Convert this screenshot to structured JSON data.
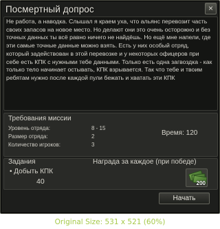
{
  "window": {
    "title": "Посмертный допрос",
    "close_label": "×"
  },
  "description": "Не работа, а наводка. Слышал я краем уха, что альянс перевозит часть своих запасов на новое место. Но делают они это очень осторожно и без точных данных ты всё равно ничего не найдёшь. Но ещё мне напели, где эти самые точные данные можно взять. Есть у них особый отряд, который задействован в этой перевозке и у некоторых офицеров при себе есть КПК с нужными тебе данными. Только есть одна загвоздка - как только тело начинает остывать, КПК взрывается. Так что тебе и твоим ребятам нужно после каждой пули бежать и хватать эти КПК",
  "mission": {
    "heading": "Требования миссии",
    "requirements": [
      {
        "label": "Уровень отряда:",
        "value": "8 - 15"
      },
      {
        "label": "Размер отряда:",
        "value": "2"
      },
      {
        "label": "Количество игроков:",
        "value": "3"
      }
    ],
    "time": "Время: 120"
  },
  "tasks": {
    "heading": "Задания",
    "reward_heading": "Награда за каждое (при победе)",
    "items": [
      {
        "name": "Добыть КПК",
        "bullet": "•",
        "count": "40",
        "reward_icon": "money-bills-icon",
        "reward_amount": "200"
      }
    ]
  },
  "buttons": {
    "start": "Начать"
  },
  "caption": "Original Size: 531 x 521 (60%)",
  "colors": {
    "window_bg": "#1d1e1c",
    "panel_bg": "#292a27",
    "text": "#d9d7d0",
    "caption": "#a6c94a"
  }
}
